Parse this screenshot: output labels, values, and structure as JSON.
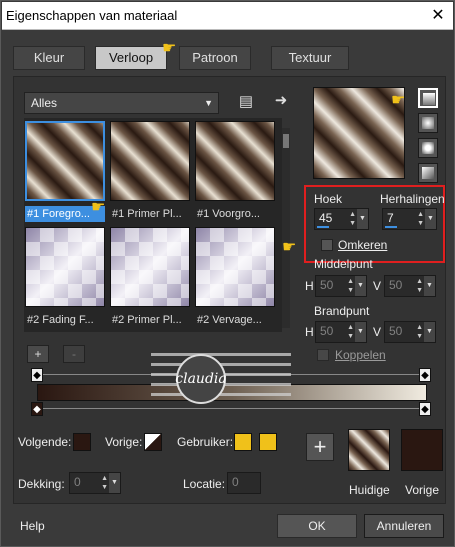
{
  "window": {
    "title": "Eigenschappen van materiaal",
    "close_glyph": "✕"
  },
  "tabs": [
    {
      "label": "Kleur",
      "active": false
    },
    {
      "label": "Verloop",
      "active": true
    },
    {
      "label": "Patroon",
      "active": false
    },
    {
      "label": "Textuur",
      "active": false
    }
  ],
  "category": {
    "value": "Alles"
  },
  "gallery": {
    "items": [
      {
        "label": "#1 Foregro...",
        "style": "brown",
        "selected": true
      },
      {
        "label": "#1 Primer Pl...",
        "style": "brown",
        "selected": false
      },
      {
        "label": "#1 Voorgro...",
        "style": "brown",
        "selected": false
      },
      {
        "label": "#2 Fading F...",
        "style": "lilac",
        "selected": false
      },
      {
        "label": "#2 Primer Pl...",
        "style": "lilac",
        "selected": false
      },
      {
        "label": "#2 Vervage...",
        "style": "lilac",
        "selected": false
      }
    ]
  },
  "settings": {
    "hoek_label": "Hoek",
    "hoek_value": "45",
    "herhalingen_label": "Herhalingen",
    "herhalingen_value": "7",
    "omkeren_label": "Omkeren",
    "middelpunt_label": "Middelpunt",
    "middelpunt_h": "50",
    "middelpunt_v": "50",
    "brandpunt_label": "Brandpunt",
    "brandpunt_h": "50",
    "brandpunt_v": "50",
    "koppelen_label": "Koppelen",
    "h_label": "H",
    "v_label": "V"
  },
  "editor": {
    "add_label": "+",
    "remove_label": "-"
  },
  "bottom": {
    "volgende_label": "Volgende:",
    "vorige_label": "Vorige:",
    "gebruiker_label": "Gebruiker:",
    "dekking_label": "Dekking:",
    "dekking_value": "0",
    "locatie_label": "Locatie:",
    "locatie_value": "0",
    "huidige_label": "Huidige",
    "vorige_big_label": "Vorige",
    "plus_label": "+"
  },
  "footer": {
    "help_label": "Help",
    "ok_label": "OK",
    "cancel_label": "Annuleren"
  },
  "watermark": {
    "text": "claudia"
  },
  "colors": {
    "accent": "#3d8fe0",
    "highlight_box": "#e01f1f",
    "dark_brown": "#2a1711",
    "gold": "#f0c11a"
  }
}
